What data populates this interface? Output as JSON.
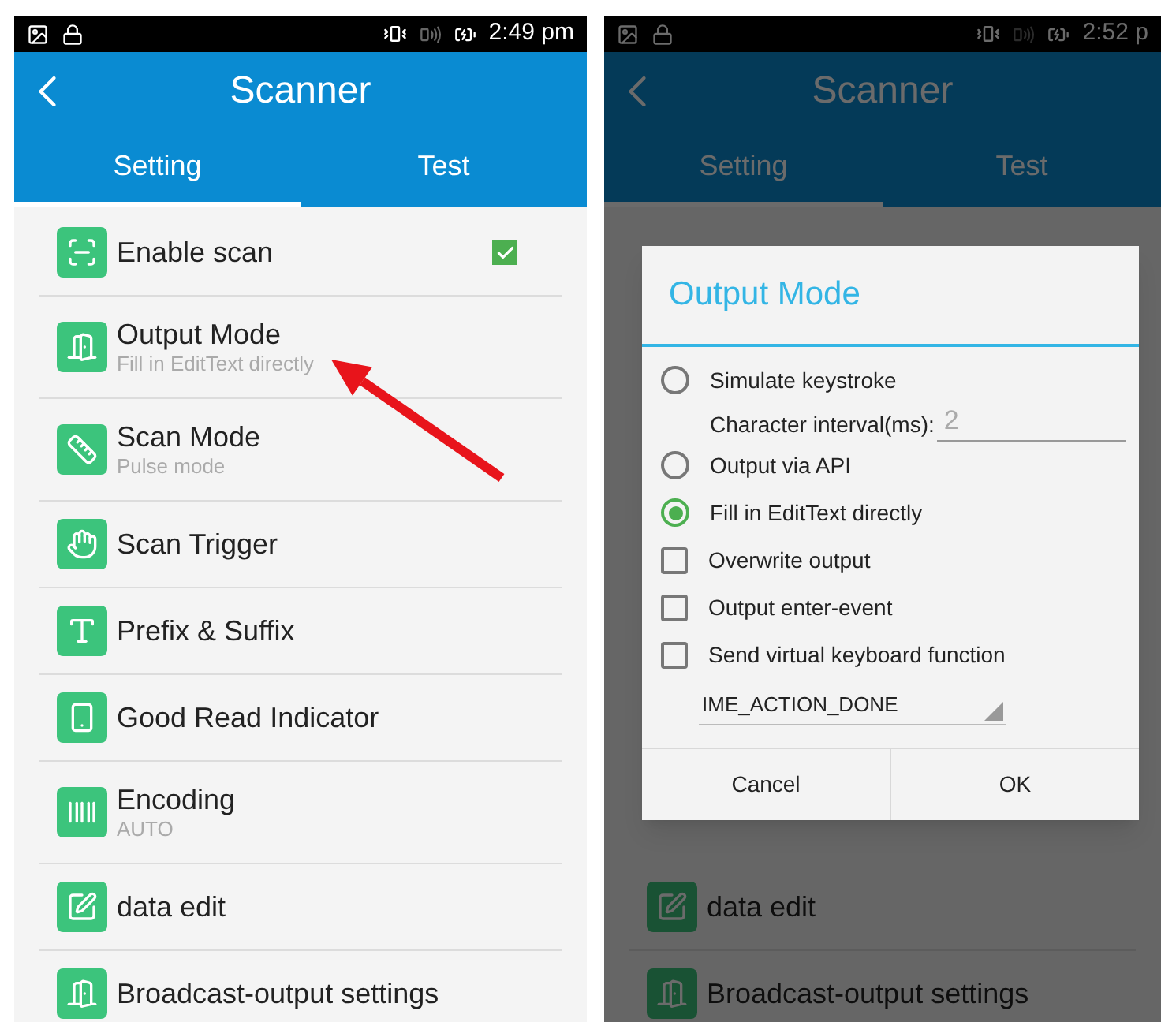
{
  "screens": [
    {
      "status_bar": {
        "time": "2:49 pm"
      },
      "toolbar": {
        "title": "Scanner"
      },
      "tabs": [
        {
          "label": "Setting",
          "selected": true
        },
        {
          "label": "Test",
          "selected": false
        }
      ],
      "dimmed": false,
      "items": [
        {
          "kind": "scan",
          "title": "Enable scan",
          "checked": true
        },
        {
          "kind": "output",
          "title": "Output Mode",
          "subtitle": "Fill in EditText directly"
        },
        {
          "kind": "mode",
          "title": "Scan Mode",
          "subtitle": "Pulse mode"
        },
        {
          "kind": "trigger",
          "title": "Scan Trigger"
        },
        {
          "kind": "prefix",
          "title": "Prefix & Suffix"
        },
        {
          "kind": "indicator",
          "title": "Good Read Indicator"
        },
        {
          "kind": "barcode",
          "title": "Encoding",
          "subtitle": "AUTO"
        },
        {
          "kind": "edit",
          "title": "data edit"
        },
        {
          "kind": "output",
          "title": "Broadcast-output settings"
        }
      ]
    },
    {
      "status_bar": {
        "time": "2:52 p"
      },
      "toolbar": {
        "title": "Scanner"
      },
      "tabs": [
        {
          "label": "Setting",
          "selected": true
        },
        {
          "label": "Test",
          "selected": false
        }
      ],
      "dimmed": true,
      "items": [
        {
          "kind": "edit",
          "title": "data edit"
        },
        {
          "kind": "output",
          "title": "Broadcast-output settings"
        }
      ],
      "dialog": {
        "title": "Output Mode",
        "options": [
          {
            "kind": "radio",
            "label": "Simulate keystroke",
            "selected": false
          },
          {
            "kind": "field",
            "label": "Character interval(ms):",
            "value": "2"
          },
          {
            "kind": "radio",
            "label": "Output via API",
            "selected": false
          },
          {
            "kind": "radio",
            "label": "Fill in EditText directly",
            "selected": true
          },
          {
            "kind": "checkbox",
            "label": "Overwrite output",
            "checked": false
          },
          {
            "kind": "checkbox",
            "label": "Output enter-event",
            "checked": false
          },
          {
            "kind": "checkbox",
            "label": "Send virtual keyboard function",
            "checked": false
          },
          {
            "kind": "dropdown",
            "value": "IME_ACTION_DONE"
          }
        ],
        "buttons": [
          "Cancel",
          "OK"
        ]
      }
    }
  ]
}
